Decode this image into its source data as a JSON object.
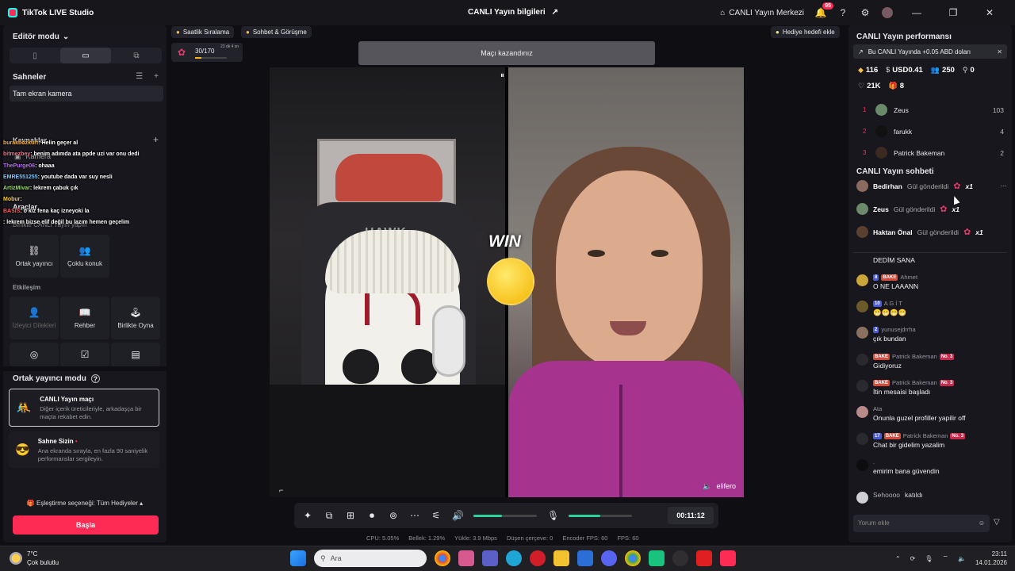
{
  "titlebar": {
    "app_name": "TikTok LIVE Studio",
    "center_title": "CANLI Yayın bilgileri",
    "live_center": "CANLI Yayın Merkezi",
    "notif_count": "95"
  },
  "left": {
    "editor_mode": "Editör modu",
    "scenes": "Sahneler",
    "scene_item": "Tam ekran kamera",
    "sources": "Kaynaklar",
    "source_cam": "Kamera",
    "tools": "Araçlar",
    "tools_sub": "Birlikte CANLI Yayın yapın",
    "tool_cohost": "Ortak yayıncı",
    "tool_multi": "Çoklu konuk",
    "interaction": "Etkileşim",
    "tool_viewer": "İzleyici Dilekleri",
    "tool_guide": "Rehber",
    "tool_play": "Birlikte Oyna",
    "cohost_mode": "Ortak yayıncı modu",
    "card1_title": "CANLI Yayın maçı",
    "card1_desc": "Diğer içerik üreticileriyle, arkadaşça bir maçta rekabet edin.",
    "card2_title": "Sahne Sizin",
    "card2_desc": "Ana ekranda sırayla, en fazla 90 saniyelik performanslar sergileyin.",
    "match_option": "Eşleştirme seçeneği: Tüm Hediyeler",
    "start": "Başla"
  },
  "overlay_chat": [
    {
      "user": "burakbozkurt",
      "text": ": Helin geçer al",
      "color": "#f5b042"
    },
    {
      "user": "bitmezbey",
      "text": ": benim adımda ata ppde uzi var onu dedi",
      "color": "#ff6a8a"
    },
    {
      "user": "ThePurge06",
      "text": ": ohaaa",
      "color": "#c06cff"
    },
    {
      "user": "EMRE551255",
      "text": ": youtube dada var suy nesli",
      "color": "#7ec8ff"
    },
    {
      "user": "ArtizMivar",
      "text": ": lekrem çabuk çık",
      "color": "#9ad86a"
    },
    {
      "user": "Mobur",
      "text": ":",
      "color": "#ffcc44"
    },
    {
      "user": "BASIS",
      "text": ": o kız fena kaç izneyoki la",
      "color": "#ff5a5a"
    },
    {
      "user": "",
      "text": ": lekrem bizse elif değil bu lazım hemen geçelim",
      "color": "#ffffff"
    }
  ],
  "top_chips": {
    "hourly": "Saatlik Sıralama",
    "chat": "Sohbet & Görüşme",
    "gift_goal": "Hediye hedefi ekle",
    "gift_progress": "30/170",
    "gift_timer": "23 dk 4 sn"
  },
  "stage": {
    "banner": "Maçı kazandınız",
    "win": "WIN",
    "streamer": "elifero",
    "hawk": "HAWK"
  },
  "controls": {
    "timer": "00:11:12",
    "volume_fraction": 0.45,
    "mic_fraction": 0.5
  },
  "stats": {
    "cpu": "CPU: 5.05%",
    "mem": "Bellek: 1.29%",
    "upload": "Yükle: 3.9 Mbps",
    "dropped": "Düşen çerçeve: 0",
    "encoder": "Encoder FPS: 60",
    "fps": "FPS: 60"
  },
  "right": {
    "perf": "CANLI Yayın performansı",
    "earn": "Bu CANLI Yayında +0.05 ABD doları",
    "s_gems": "116",
    "s_usd": "USD0.41",
    "s_viewers": "250",
    "s_shares": "0",
    "s_likes": "21K",
    "s_gifts": "8",
    "ranking": [
      {
        "rank": "1",
        "name": "Zeus",
        "value": "103"
      },
      {
        "rank": "2",
        "name": "farukk",
        "value": "4"
      },
      {
        "rank": "3",
        "name": "Patrick Bakeman",
        "value": "2"
      }
    ],
    "chat_title": "CANLI Yayın sohbeti",
    "gifts": [
      {
        "name": "Bedirhan",
        "text": "Gül gönderildi",
        "count": "x1"
      },
      {
        "name": "Zeus",
        "text": "Gül gönderildi",
        "count": "x1"
      },
      {
        "name": "Haktan Önal",
        "text": "Gül gönderildi",
        "count": "x1"
      }
    ],
    "messages": [
      {
        "user": "",
        "text": "DEDİM SANA"
      },
      {
        "user": "Ahmet",
        "text": "O NE LAAANN"
      },
      {
        "user": "A G İ T",
        "text": "😁😁😁😁"
      },
      {
        "user": "yunusejdrrha",
        "text": "çık bundan"
      },
      {
        "user": "Patrick Bakeman",
        "text": "Gidiyoruz"
      },
      {
        "user": "Patrick Bakeman",
        "text": "İtin mesaisi başladı"
      },
      {
        "user": "Ata",
        "text": "Onunla guzel profiller yapilir off"
      },
      {
        "user": "Patrick Bakeman",
        "text": "Chat bir gidelim yazalim"
      },
      {
        "user": ".",
        "text": "emirim bana güvendin"
      }
    ],
    "joined_user": "Sehoooo",
    "joined_text": "katıldı",
    "input_placeholder": "Yorum ekle",
    "badge_8": "8",
    "badge_10": "10",
    "badge_2": "2",
    "badge_17": "17",
    "badge_bake": "BAKE",
    "badge_no3": "No. 3"
  },
  "taskbar": {
    "temp": "7°C",
    "weather": "Çok bulutlu",
    "search": "Ara",
    "time": "23:11",
    "date": "14.01.2026",
    "weather_badge": "3"
  }
}
